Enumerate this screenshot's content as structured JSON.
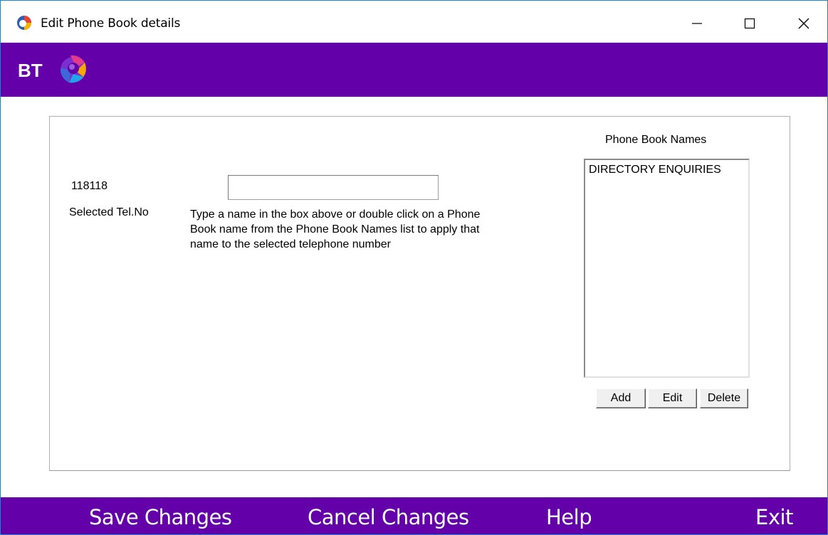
{
  "window": {
    "title": "Edit Phone Book details"
  },
  "brand": {
    "logo_text": "BT",
    "purple": "#6400aa"
  },
  "form": {
    "selected_tel_value": "118118",
    "selected_tel_label": "Selected Tel.No",
    "name_input_value": "",
    "help_text": "Type a name in the box above or double click on a Phone Book name from the Phone Book Names list to apply that name to the selected telephone number"
  },
  "phonebook": {
    "heading": "Phone Book Names",
    "items": [
      "DIRECTORY ENQUIRIES"
    ],
    "add_label": "Add",
    "edit_label": "Edit",
    "delete_label": "Delete"
  },
  "footer": {
    "save_label": "Save Changes",
    "cancel_label": "Cancel Changes",
    "help_label": "Help",
    "exit_label": "Exit"
  }
}
